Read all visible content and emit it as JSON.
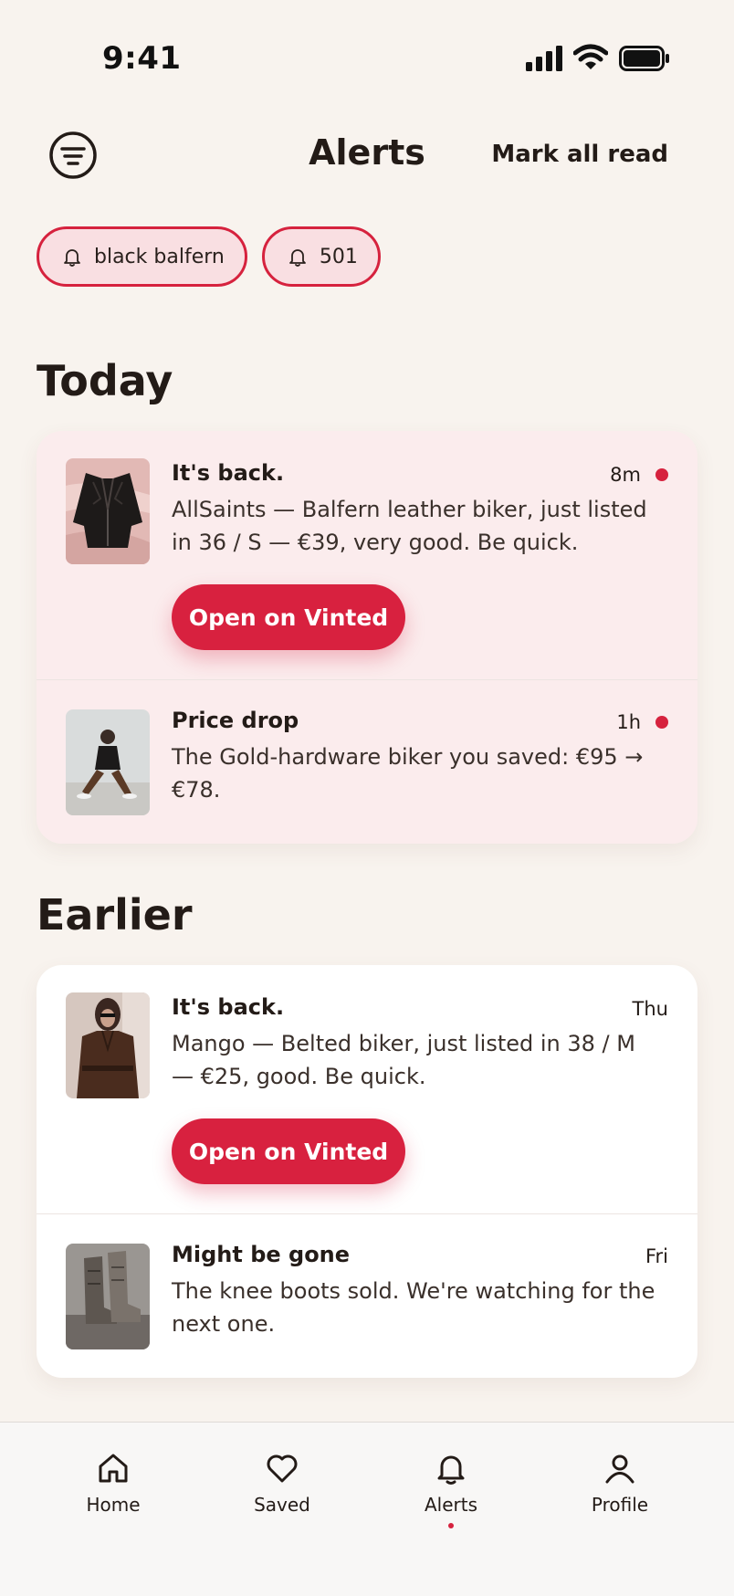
{
  "status_bar": {
    "time": "9:41"
  },
  "header": {
    "title": "Alerts",
    "mark_all_label": "Mark all read"
  },
  "chips": [
    {
      "label": "black balfern",
      "icon": "bell-icon"
    },
    {
      "label": "501",
      "icon": "bell-icon"
    }
  ],
  "sections": {
    "today": {
      "title": "Today"
    },
    "earlier": {
      "title": "Earlier"
    }
  },
  "alerts": {
    "today": [
      {
        "title": "It's back.",
        "time": "8m",
        "unread": true,
        "body": "AllSaints — Balfern leather biker, just listed in 36 / S — €39, very good. Be quick.",
        "button": "Open on Vinted"
      },
      {
        "title": "Price drop",
        "time": "1h",
        "unread": true,
        "body": "The Gold-hardware biker you saved: €95 → €78."
      }
    ],
    "earlier": [
      {
        "title": "It's back.",
        "time": "Thu",
        "unread": false,
        "body": "Mango — Belted biker, just listed in 38 / M — €25, good. Be quick.",
        "button": "Open on Vinted"
      },
      {
        "title": "Might be gone",
        "time": "Fri",
        "unread": false,
        "body": "The knee boots sold. We're watching for the next one."
      }
    ]
  },
  "tabbar": {
    "active": "Alerts",
    "items": [
      {
        "label": "Home",
        "icon": "home-icon"
      },
      {
        "label": "Saved",
        "icon": "heart-icon"
      },
      {
        "label": "Alerts",
        "icon": "bell-icon"
      },
      {
        "label": "Profile",
        "icon": "person-icon"
      }
    ]
  },
  "colors": {
    "accent": "#d6223e",
    "background": "#f8f3ee",
    "unread_card": "#fbeced",
    "card": "#ffffff"
  }
}
